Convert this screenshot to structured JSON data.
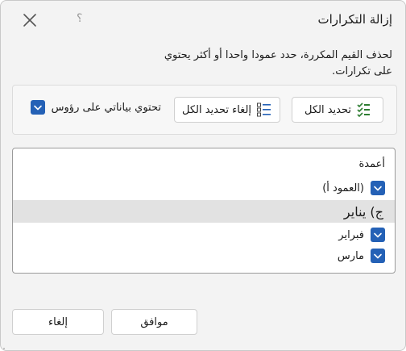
{
  "dialog": {
    "title": "إزالة التكرارات",
    "help_label": "؟",
    "instruction": "لحذف القيم المكررة، حدد عمودا واحدا أو أكثر يحتوي على تكرارات."
  },
  "toolbar": {
    "select_all_label": "تحديد الكل",
    "unselect_all_label": "إلغاء تحديد الكل",
    "has_headers_label": "تحتوي بياناتي على رؤوس",
    "has_headers_checked": true
  },
  "columns": {
    "header": "أعمدة",
    "items": [
      {
        "label": "(العمود أ)",
        "checked": true
      },
      {
        "label": "ج) يناير",
        "checked": false,
        "highlighted": true
      },
      {
        "label": "فبراير",
        "checked": true
      },
      {
        "label": "مارس",
        "checked": true
      }
    ]
  },
  "footer": {
    "ok_label": "موافق",
    "cancel_label": "إلغاء"
  },
  "colors": {
    "accent": "#2461b6",
    "highlight_row": "#e2e2e2",
    "dialog_background": "#f3f3f3"
  },
  "icons": {
    "close": "close-icon",
    "select_all": "select-all-checklist-icon",
    "unselect_all": "unselect-all-list-icon",
    "checkbox": "checkmark-icon"
  }
}
